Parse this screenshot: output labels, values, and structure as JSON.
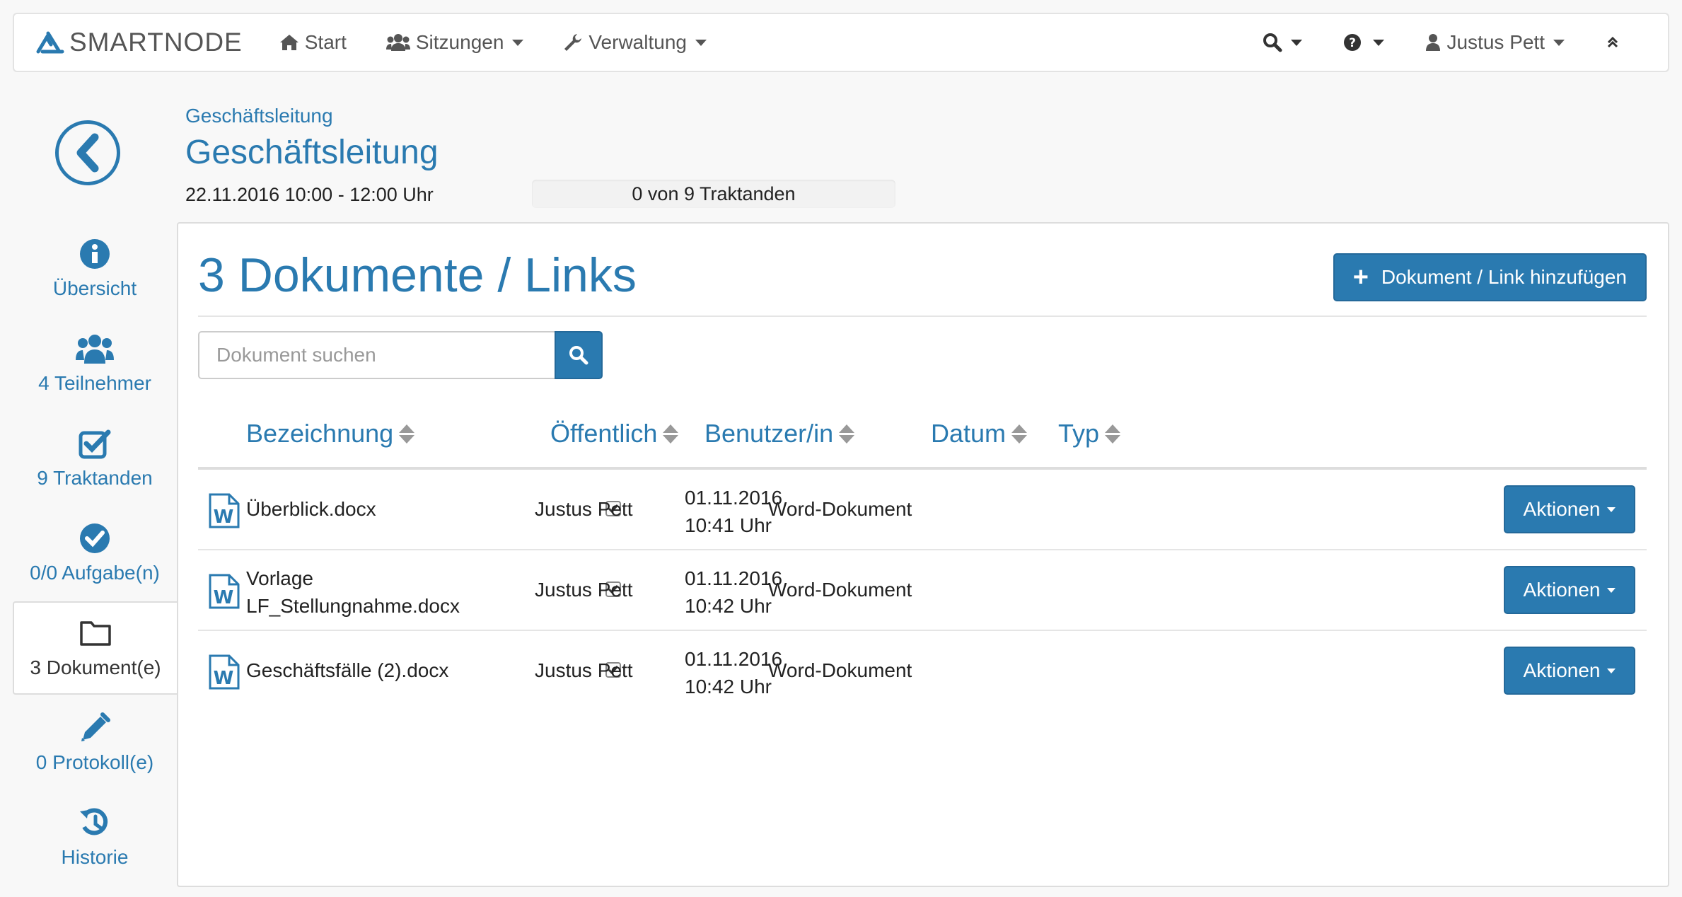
{
  "navbar": {
    "brand": "SMARTNODE",
    "items": [
      {
        "label": "Start",
        "icon": "home-icon"
      },
      {
        "label": "Sitzungen",
        "icon": "users-icon"
      },
      {
        "label": "Verwaltung",
        "icon": "wrench-icon"
      }
    ],
    "user": "Justus Pett"
  },
  "sidebar": {
    "items": [
      {
        "label": "Übersicht",
        "icon": "info-icon"
      },
      {
        "label": "4 Teilnehmer",
        "icon": "users-icon"
      },
      {
        "label": "9 Traktanden",
        "icon": "checkbox-icon"
      },
      {
        "label": "0/0 Aufgabe(n)",
        "icon": "check-circle-icon"
      },
      {
        "label": "3 Dokument(e)",
        "icon": "folder-icon"
      },
      {
        "label": "0 Protokoll(e)",
        "icon": "pencil-icon"
      },
      {
        "label": "Historie",
        "icon": "history-icon"
      }
    ]
  },
  "header": {
    "breadcrumb": "Geschäftsleitung",
    "title": "Geschäftsleitung",
    "datetime": "22.11.2016 10:00 - 12:00 Uhr",
    "progress_text": "0 von 9 Traktanden",
    "progress_value": 0
  },
  "main": {
    "title": "3 Dokumente / Links",
    "add_button": "Dokument / Link hinzufügen",
    "search": {
      "placeholder": "Dokument suchen",
      "value": ""
    },
    "columns": [
      "Bezeichnung",
      "Öffentlich",
      "Benutzer/in",
      "Datum",
      "Typ"
    ],
    "rows": [
      {
        "name_line1": "Überblick.docx",
        "name_line2": "",
        "public": true,
        "user": "Justus Pett",
        "date": "01.11.2016",
        "time": "10:41 Uhr",
        "type": "Word-Dokument",
        "action": "Aktionen"
      },
      {
        "name_line1": "Vorlage",
        "name_line2": "LF_Stellungnahme.docx",
        "public": true,
        "user": "Justus Pett",
        "date": "01.11.2016",
        "time": "10:42 Uhr",
        "type": "Word-Dokument",
        "action": "Aktionen"
      },
      {
        "name_line1": "Geschäftsfälle (2).docx",
        "name_line2": "",
        "public": true,
        "user": "Justus Pett",
        "date": "01.11.2016",
        "time": "10:42 Uhr",
        "type": "Word-Dokument",
        "action": "Aktionen"
      }
    ]
  },
  "colors": {
    "accent": "#2a7ab0",
    "background": "#f8f8f8"
  }
}
